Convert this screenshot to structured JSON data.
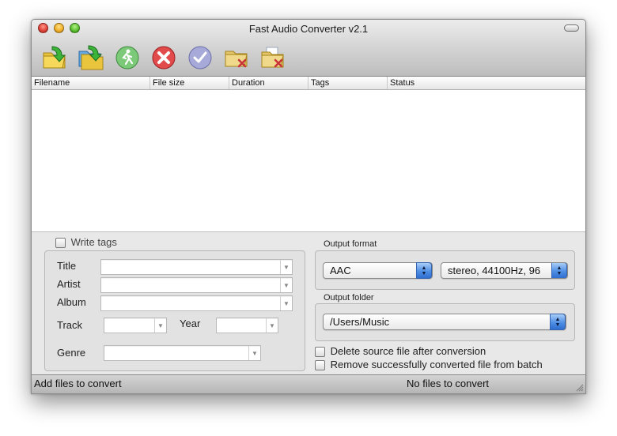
{
  "window": {
    "title": "Fast Audio Converter v2.1"
  },
  "toolbar": {
    "buttons": [
      {
        "name": "add-files-button",
        "icon": "folder-add-icon"
      },
      {
        "name": "add-folder-button",
        "icon": "folder-add-recursive-icon"
      },
      {
        "name": "start-convert-button",
        "icon": "run-icon"
      },
      {
        "name": "stop-button",
        "icon": "stop-icon"
      },
      {
        "name": "check-button",
        "icon": "checkmark-icon"
      },
      {
        "name": "remove-file-button",
        "icon": "folder-remove-icon"
      },
      {
        "name": "clear-batch-button",
        "icon": "folder-clear-icon"
      }
    ]
  },
  "table": {
    "columns": [
      "Filename",
      "File size",
      "Duration",
      "Tags",
      "Status"
    ],
    "rows": []
  },
  "tags": {
    "write_tags_label": "Write tags",
    "write_tags_checked": false,
    "title_label": "Title",
    "artist_label": "Artist",
    "album_label": "Album",
    "track_label": "Track",
    "year_label": "Year",
    "genre_label": "Genre",
    "title_value": "",
    "artist_value": "",
    "album_value": "",
    "track_value": "",
    "year_value": "",
    "genre_value": ""
  },
  "output": {
    "format_label": "Output format",
    "format_value": "AAC",
    "format_options_value": "stereo, 44100Hz, 96",
    "folder_label": "Output folder",
    "folder_value": "/Users/Music",
    "delete_source_label": "Delete source file after conversion",
    "delete_source_checked": false,
    "remove_converted_label": "Remove successfully converted file from batch",
    "remove_converted_checked": false
  },
  "status": {
    "left": "Add files to convert",
    "right": "No files to convert"
  },
  "colors": {
    "accent_blue": "#4f8fe4",
    "close_red": "#e0443a",
    "minimize_yellow": "#f0b029",
    "zoom_green": "#5ec232"
  }
}
